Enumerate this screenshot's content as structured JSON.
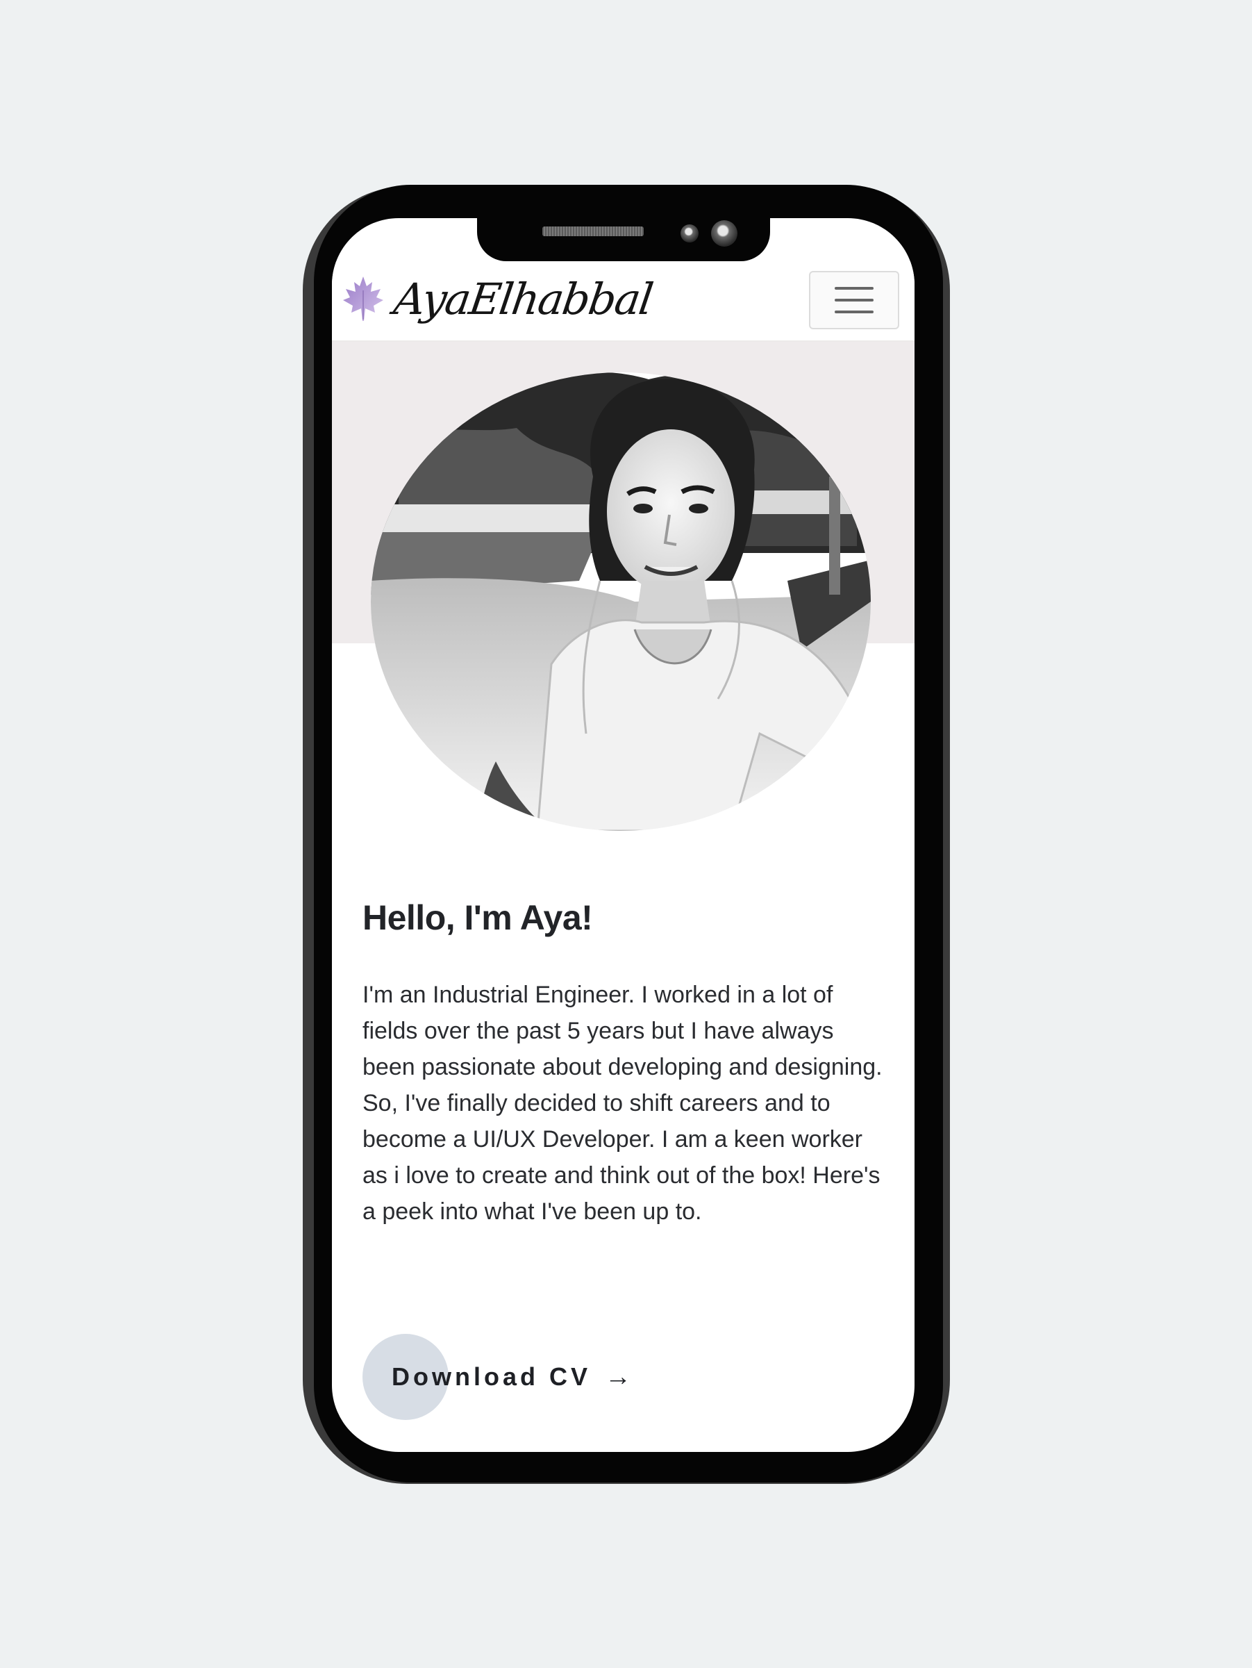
{
  "header": {
    "brand_name": "AyaElhabbal",
    "logo_icon": "maple-leaf-icon",
    "menu_icon": "hamburger-menu-icon"
  },
  "hero": {
    "photo_icon": "profile-photo"
  },
  "intro": {
    "greeting": "Hello, I'm Aya!",
    "paragraphs": [
      "I'm an Industrial Engineer. I worked in a lot of fields over the past 5 years but I have always been passionate about developing and designing.",
      "So, I've finally decided to shift careers and to become a UI/UX Developer. I am a keen worker as i love to create and think out of the box! Here's a peek into what I've been up to."
    ]
  },
  "cta": {
    "download_label": "Download CV",
    "arrow": "→"
  },
  "colors": {
    "page_background": "#eef1f2",
    "phone_frame": "#050505",
    "hero_band": "#efebec",
    "cta_circle": "#d7dde5",
    "leaf": "#b69ad6"
  }
}
